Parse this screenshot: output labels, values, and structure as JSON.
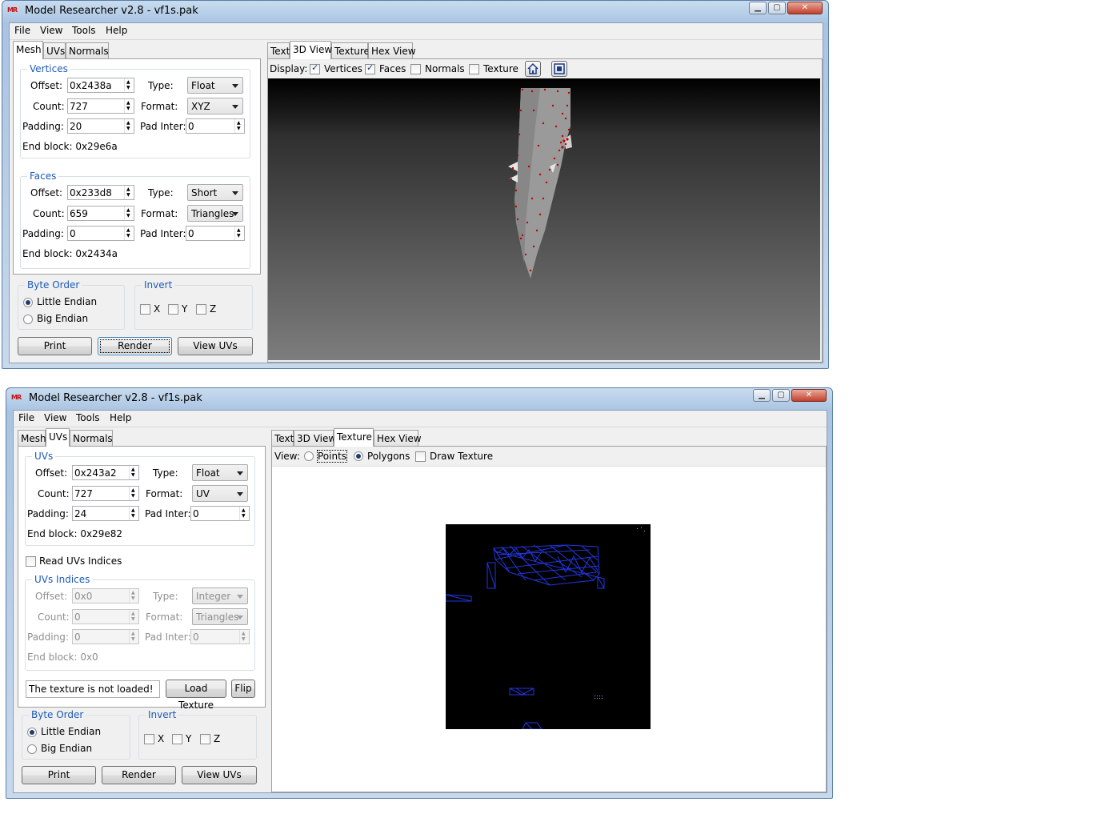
{
  "window1": {
    "title": "Model Researcher v2.8 - vf1s.pak",
    "menu": [
      "File",
      "View",
      "Tools",
      "Help"
    ],
    "left_tabs": [
      "Mesh",
      "UVs",
      "Normals"
    ],
    "active_left_tab": "Mesh",
    "vertices": {
      "label": "Vertices",
      "offset_label": "Offset:",
      "offset": "0x2438a",
      "type_label": "Type:",
      "type": "Float",
      "count_label": "Count:",
      "count": "727",
      "format_label": "Format:",
      "format": "XYZ",
      "padding_label": "Padding:",
      "padding": "20",
      "pad_inter_label": "Pad Inter:",
      "pad_inter": "0",
      "end_block": "End block: 0x29e6a"
    },
    "faces": {
      "label": "Faces",
      "offset_label": "Offset:",
      "offset": "0x233d8",
      "type_label": "Type:",
      "type": "Short",
      "count_label": "Count:",
      "count": "659",
      "format_label": "Format:",
      "format": "Triangles",
      "padding_label": "Padding:",
      "padding": "0",
      "pad_inter_label": "Pad Inter:",
      "pad_inter": "0",
      "end_block": "End block: 0x2434a"
    },
    "byte_order": {
      "label": "Byte Order",
      "little": "Little Endian",
      "big": "Big Endian",
      "selected": "little"
    },
    "invert": {
      "label": "Invert",
      "x": "X",
      "y": "Y",
      "z": "Z"
    },
    "buttons": {
      "print": "Print",
      "render": "Render",
      "view_uvs": "View UVs"
    },
    "right_tabs": [
      "Text",
      "3D View",
      "Texture",
      "Hex View"
    ],
    "active_right_tab": "3D View",
    "display": {
      "label": "Display:",
      "vertices": "Vertices",
      "vertices_checked": true,
      "faces": "Faces",
      "faces_checked": true,
      "normals": "Normals",
      "normals_checked": false,
      "texture": "Texture",
      "texture_checked": false
    },
    "icons": {
      "home": "home-icon",
      "fit": "zoom-extents-icon"
    },
    "viewport_colors": {
      "top": "#000000",
      "bottom": "#7d7d7d",
      "mesh": "#9a9a9a",
      "vertex": "#c00000"
    }
  },
  "window2": {
    "title": "Model Researcher v2.8 - vf1s.pak",
    "menu": [
      "File",
      "View",
      "Tools",
      "Help"
    ],
    "left_tabs": [
      "Mesh",
      "UVs",
      "Normals"
    ],
    "active_left_tab": "UVs",
    "uvs": {
      "label": "UVs",
      "offset_label": "Offset:",
      "offset": "0x243a2",
      "type_label": "Type:",
      "type": "Float",
      "count_label": "Count:",
      "count": "727",
      "format_label": "Format:",
      "format": "UV",
      "padding_label": "Padding:",
      "padding": "24",
      "pad_inter_label": "Pad Inter:",
      "pad_inter": "0",
      "end_block": "End block: 0x29e82"
    },
    "read_uv_indices": "Read UVs Indices",
    "uv_indices": {
      "label": "UVs Indices",
      "offset_label": "Offset:",
      "offset": "0x0",
      "type_label": "Type:",
      "type": "Integer",
      "count_label": "Count:",
      "count": "0",
      "format_label": "Format:",
      "format": "Triangles",
      "padding_label": "Padding:",
      "padding": "0",
      "pad_inter_label": "Pad Inter:",
      "pad_inter": "0",
      "end_block": "End block: 0x0"
    },
    "texture_status": "The texture is not loaded!",
    "load_texture": "Load Texture",
    "flip": "Flip",
    "byte_order": {
      "label": "Byte Order",
      "little": "Little Endian",
      "big": "Big Endian",
      "selected": "little"
    },
    "invert": {
      "label": "Invert",
      "x": "X",
      "y": "Y",
      "z": "Z"
    },
    "buttons": {
      "print": "Print",
      "render": "Render",
      "view_uvs": "View UVs"
    },
    "right_tabs": [
      "Text",
      "3D View",
      "Texture",
      "Hex View"
    ],
    "active_right_tab": "Texture",
    "view": {
      "label": "View:",
      "points": "Points",
      "polygons": "Polygons",
      "selected": "polygons",
      "draw_texture": "Draw Texture"
    },
    "uv_colors": {
      "background": "#000000",
      "lines": "#1a2fd6"
    }
  }
}
